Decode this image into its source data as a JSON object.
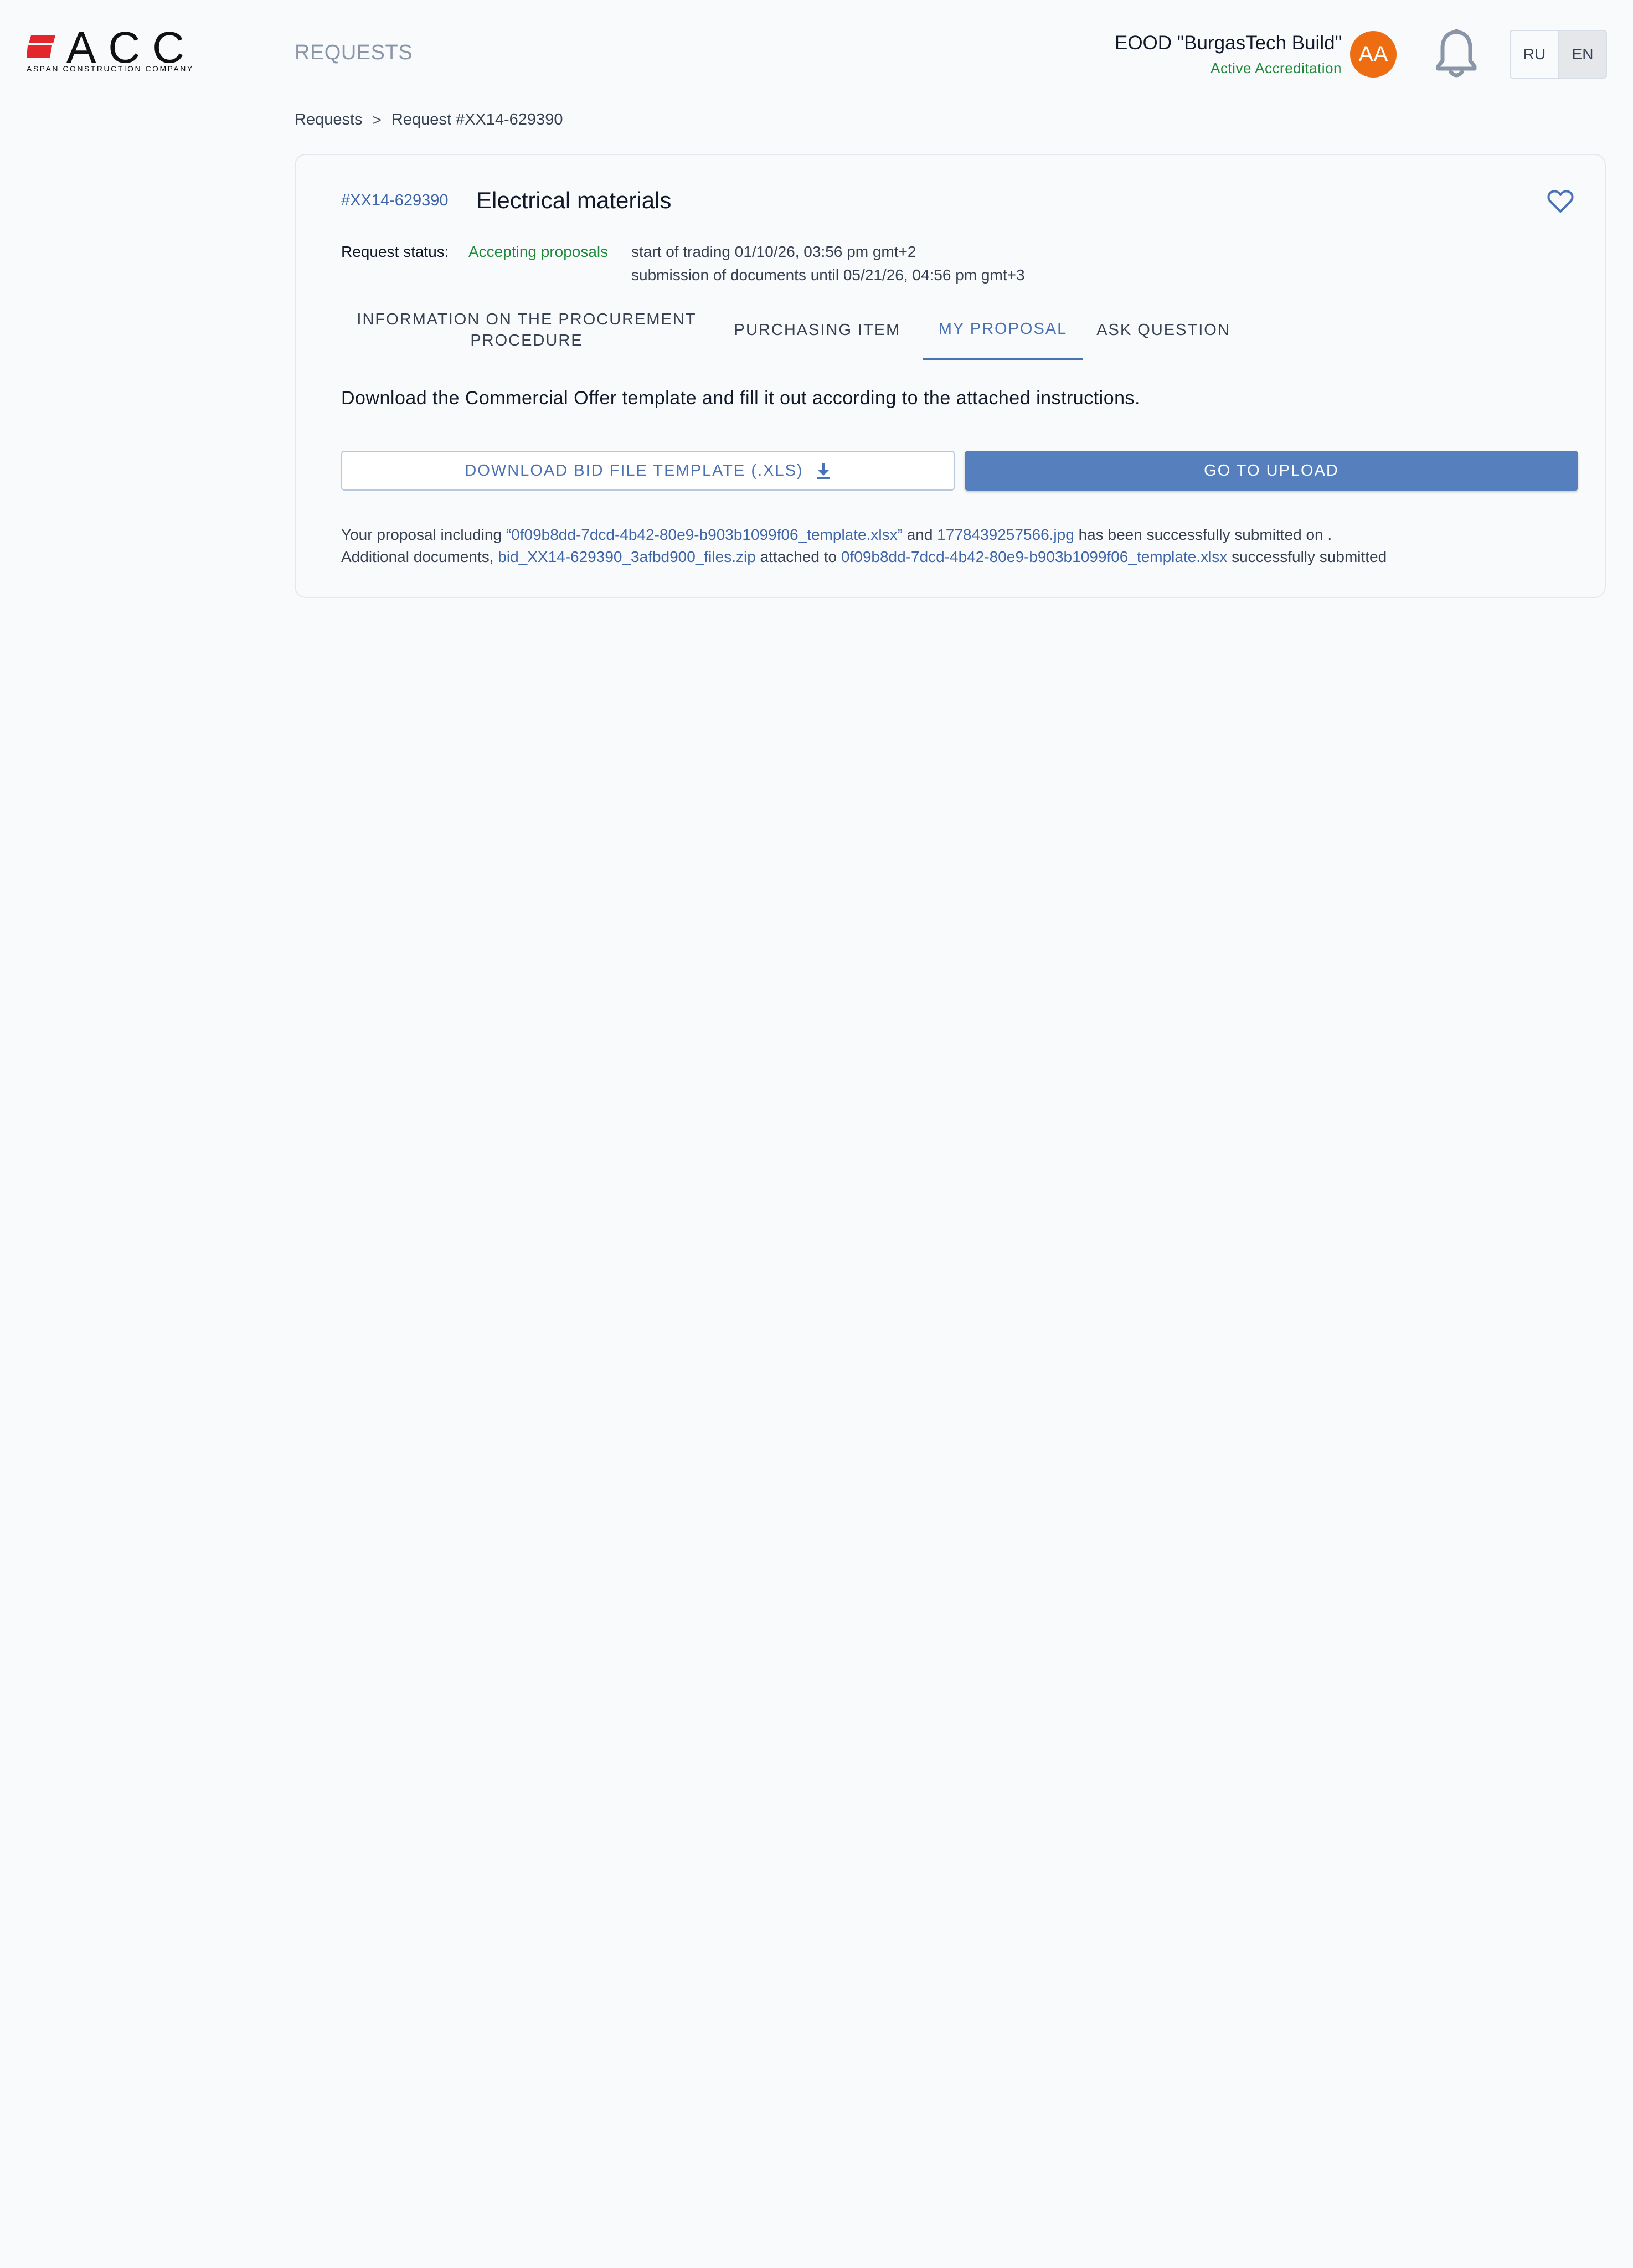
{
  "header": {
    "logo_text": "ACC",
    "logo_subtitle": "ASPAN CONSTRUCTION COMPANY",
    "page_title": "REQUESTS",
    "company_name": "EOOD \"BurgasTech Build\"",
    "company_status": "Active Accreditation",
    "avatar_initials": "AA",
    "languages": [
      "RU",
      "EN"
    ],
    "active_language": "EN"
  },
  "breadcrumb": {
    "items": [
      "Requests",
      "Request #XX14-629390"
    ],
    "separator": ">"
  },
  "request": {
    "id": "#XX14-629390",
    "title": "Electrical materials",
    "status_label": "Request status:",
    "status_value": "Accepting proposals",
    "start_of_trading": "start of trading 01/10/26, 03:56 pm gmt+2",
    "submission_until": "submission of documents until 05/21/26, 04:56 pm gmt+3"
  },
  "tabs": [
    {
      "label": "INFORMATION ON THE PROCUREMENT PROCEDURE",
      "active": false
    },
    {
      "label": "PURCHASING ITEM",
      "active": false
    },
    {
      "label": "MY PROPOSAL",
      "active": true
    },
    {
      "label": "ASK QUESTION",
      "active": false
    }
  ],
  "proposal": {
    "instructions": "Download the Commercial Offer template and fill it out according to the attached instructions.",
    "download_button": "DOWNLOAD BID FILE TEMPLATE (.XLS)",
    "upload_button": "GO TO UPLOAD",
    "line1": {
      "prefix": "Your proposal including ",
      "file1": "“0f09b8dd-7dcd-4b42-80e9-b903b1099f06_template.xlsx”",
      "middle": " and ",
      "file2": "1778439257566.jpg",
      "suffix": " has been successfully submitted on ."
    },
    "line2": {
      "prefix": "Additional documents, ",
      "file1": "bid_XX14-629390_3afbd900_files.zip",
      "middle": " attached to ",
      "file2": "0f09b8dd-7dcd-4b42-80e9-b903b1099f06_template.xlsx",
      "suffix": " successfully submitted"
    }
  },
  "colors": {
    "accent": "#567fbd",
    "link": "#3d65a8",
    "status_green": "#1f8a3a",
    "avatar": "#ee6c12",
    "logo_red": "#e3262b"
  },
  "icons": [
    "bell-icon",
    "heart-icon",
    "download-icon",
    "chevron-right-icon"
  ]
}
